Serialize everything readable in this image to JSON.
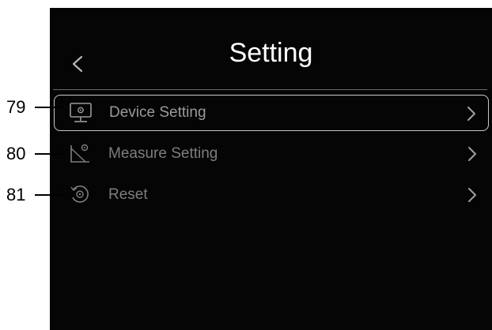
{
  "header": {
    "title": "Setting",
    "back_icon": "chevron-left-icon"
  },
  "menu": {
    "items": [
      {
        "label": "Device Setting",
        "icon": "monitor-gear-icon",
        "selected": true
      },
      {
        "label": "Measure Setting",
        "icon": "measure-gear-icon",
        "selected": false
      },
      {
        "label": "Reset",
        "icon": "reset-gear-icon",
        "selected": false
      }
    ]
  },
  "callouts": [
    "79",
    "80",
    "81"
  ],
  "colors": {
    "screen_bg": "#050505",
    "title": "#ffffff",
    "label": "#9a9a9a",
    "selection_border": "#c9c9c9"
  }
}
